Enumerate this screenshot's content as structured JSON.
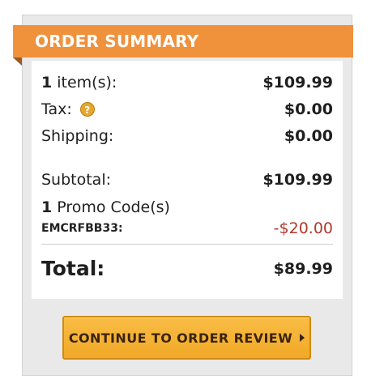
{
  "summary": {
    "title": "ORDER SUMMARY",
    "items_count": "1",
    "items_label": "item(s):",
    "items_value": "$109.99",
    "tax_label": "Tax:",
    "tax_help_icon": "question-mark-circle-icon",
    "tax_help_glyph": "?",
    "tax_value": "$0.00",
    "shipping_label": "Shipping:",
    "shipping_value": "$0.00",
    "subtotal_label": "Subtotal:",
    "subtotal_value": "$109.99",
    "promo_count": "1",
    "promo_label": "Promo Code(s)",
    "promo_code": "EMCRFBB33:",
    "promo_discount": "-$20.00",
    "total_label": "Total:",
    "total_value": "$89.99"
  },
  "actions": {
    "continue_label": "CONTINUE TO ORDER REVIEW",
    "continue_icon": "caret-right-icon"
  },
  "colors": {
    "header": "#f0913b",
    "discount": "#b03a2e",
    "button": "#f1a927"
  }
}
